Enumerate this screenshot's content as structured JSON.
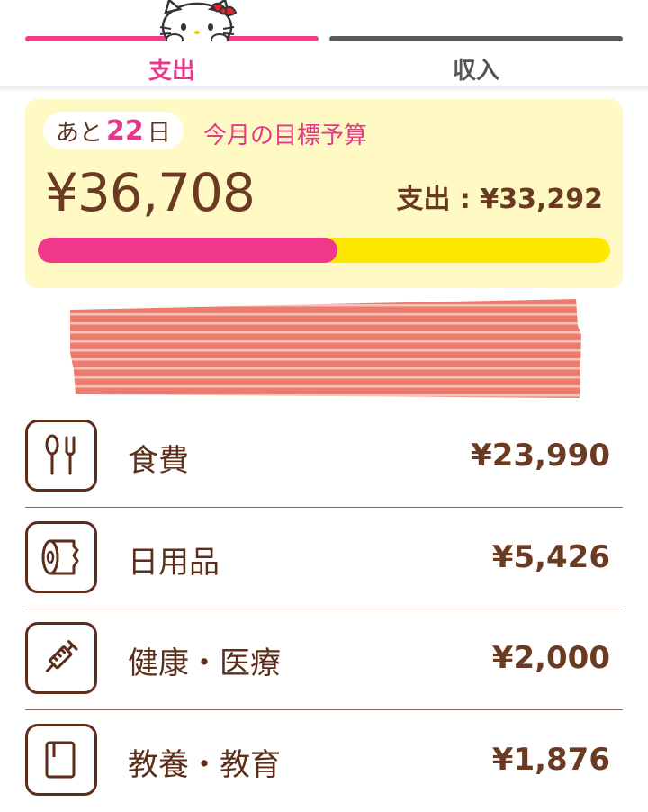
{
  "tabs": {
    "expense_label": "支出",
    "income_label": "収入"
  },
  "budget": {
    "days_prefix": "あと",
    "days_value": "22",
    "days_suffix": "日",
    "label": "今月の目標予算",
    "remaining": "¥36,708",
    "spent_summary": "支出 : ¥33,292",
    "spent_fraction": 0.524
  },
  "categories": [
    {
      "name": "食費",
      "amount": "¥23,990",
      "icon": "fork-spoon-icon"
    },
    {
      "name": "日用品",
      "amount": "¥5,426",
      "icon": "toilet-paper-icon"
    },
    {
      "name": "健康・医療",
      "amount": "¥2,000",
      "icon": "syringe-icon"
    },
    {
      "name": "教養・教育",
      "amount": "¥1,876",
      "icon": "notebook-icon"
    }
  ],
  "colors": {
    "accent_pink": "#e8368a",
    "budget_bg": "#fff9c4",
    "progress_remaining": "#ffe800",
    "text_brown": "#6b3a22"
  }
}
